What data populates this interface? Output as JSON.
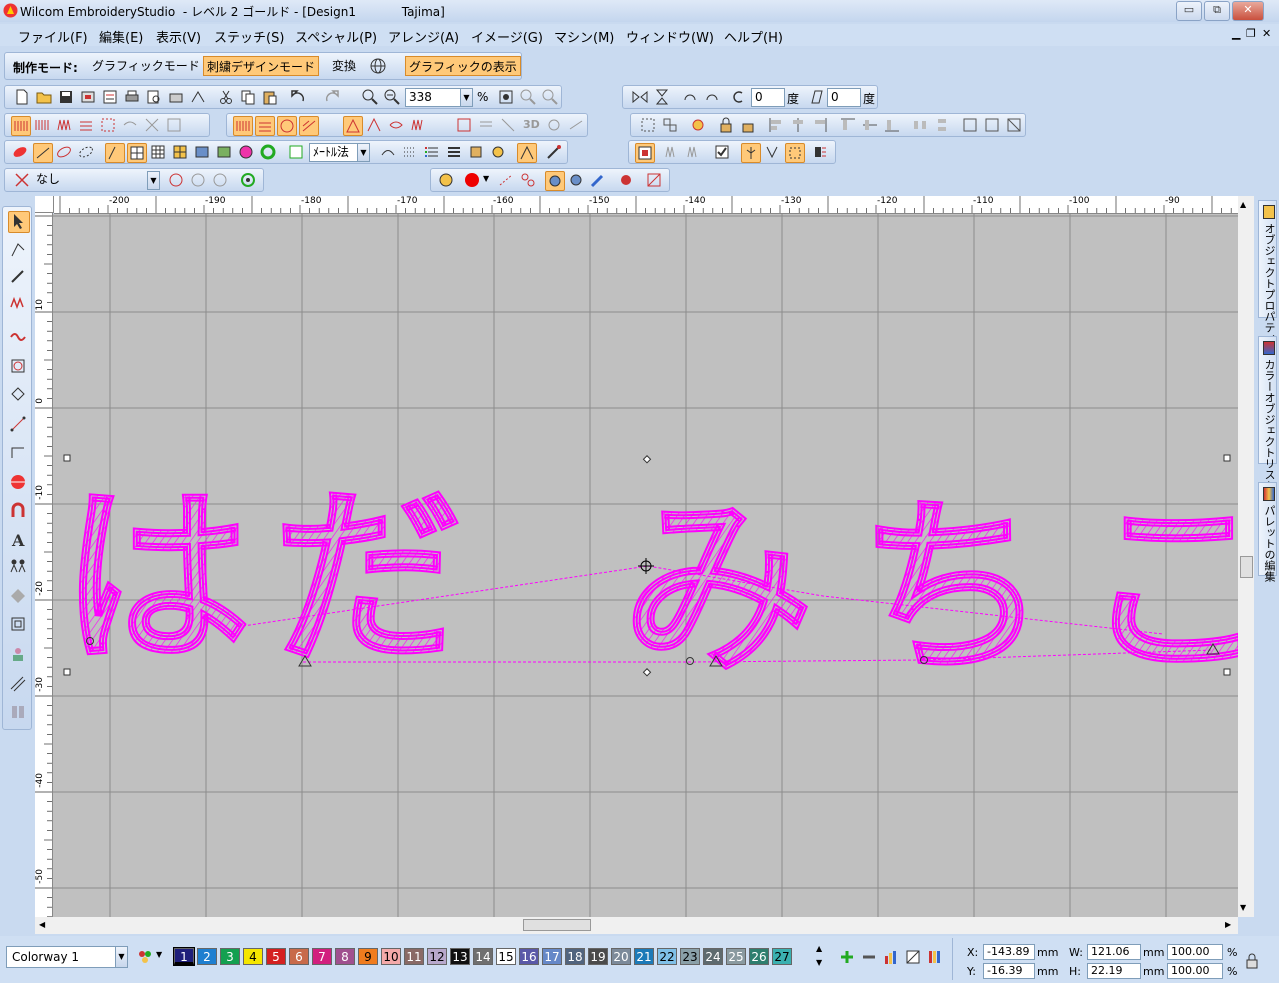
{
  "app": {
    "title": "Wilcom EmbroideryStudio  - レベル 2 ゴールド - [Design1            Tajima]",
    "window_buttons": {
      "minimize": "▭",
      "restore": "⧉",
      "close": "✕"
    },
    "mdi_buttons": {
      "minimize": "▁",
      "restore": "❐",
      "close": "✕"
    }
  },
  "menu": [
    "ファイル(F)",
    "編集(E)",
    "表示(V)",
    "ステッチ(S)",
    "スペシャル(P)",
    "アレンジ(A)",
    "イメージ(G)",
    "マシン(M)",
    "ウィンドウ(W)",
    "ヘルプ(H)"
  ],
  "mode_bar": {
    "label": "制作モード:",
    "graphic_mode": "グラフィックモード",
    "embroidery_mode": "刺繍デザインモード",
    "convert": "変換",
    "show_graphics": "グラフィックの表示"
  },
  "zoom": {
    "value": "338",
    "unit": "%"
  },
  "rotate": {
    "value": "0",
    "unit": "度"
  },
  "skew": {
    "value": "0",
    "unit": "度"
  },
  "unit_select": "ﾒｰﾄﾙ法",
  "thread_select": "なし",
  "ruler": {
    "top_labels": [
      "-200",
      "-190",
      "-180",
      "-170",
      "-160",
      "-150",
      "-140",
      "-130",
      "-120",
      "-110",
      "-100",
      "-90"
    ],
    "left_labels": [
      "10",
      "0",
      "-10",
      "-20",
      "-30",
      "-40",
      "-50"
    ]
  },
  "design_text": [
    "は",
    "だ",
    "み",
    "ち",
    "こ"
  ],
  "right_panels": [
    "オブジェクトプロパティ",
    "カラーオブジェクトリスト",
    "パレットの編集"
  ],
  "status": {
    "colorway": "Colorway 1",
    "swatches": [
      {
        "n": "1",
        "c": "#1f1f7a",
        "t": "#ffffff"
      },
      {
        "n": "2",
        "c": "#1e7fd0",
        "t": "#ffffff"
      },
      {
        "n": "3",
        "c": "#13a050",
        "t": "#ffffff"
      },
      {
        "n": "4",
        "c": "#f5e600",
        "t": "#000000"
      },
      {
        "n": "5",
        "c": "#d42020",
        "t": "#ffffff"
      },
      {
        "n": "6",
        "c": "#c86a4a",
        "t": "#ffffff"
      },
      {
        "n": "7",
        "c": "#d21f7e",
        "t": "#ffffff"
      },
      {
        "n": "8",
        "c": "#a0508f",
        "t": "#ffffff"
      },
      {
        "n": "9",
        "c": "#f07c1e",
        "t": "#000000"
      },
      {
        "n": "10",
        "c": "#f4a9a9",
        "t": "#000000"
      },
      {
        "n": "11",
        "c": "#8a6a66",
        "t": "#ffffff"
      },
      {
        "n": "12",
        "c": "#b8a8cc",
        "t": "#000000"
      },
      {
        "n": "13",
        "c": "#101010",
        "t": "#ffffff"
      },
      {
        "n": "14",
        "c": "#6f6f6f",
        "t": "#ffffff"
      },
      {
        "n": "15",
        "c": "#ffffff",
        "t": "#000000"
      },
      {
        "n": "16",
        "c": "#5a58a8",
        "t": "#ffffff"
      },
      {
        "n": "17",
        "c": "#6688c8",
        "t": "#ffffff"
      },
      {
        "n": "18",
        "c": "#51647e",
        "t": "#ffffff"
      },
      {
        "n": "19",
        "c": "#4b4b4b",
        "t": "#ffffff"
      },
      {
        "n": "20",
        "c": "#7c8a9a",
        "t": "#ffffff"
      },
      {
        "n": "21",
        "c": "#1c7ab8",
        "t": "#ffffff"
      },
      {
        "n": "22",
        "c": "#7fc0e8",
        "t": "#000000"
      },
      {
        "n": "23",
        "c": "#8aa0a8",
        "t": "#000000"
      },
      {
        "n": "24",
        "c": "#5e6a6e",
        "t": "#ffffff"
      },
      {
        "n": "25",
        "c": "#8a9aa0",
        "t": "#ffffff"
      },
      {
        "n": "26",
        "c": "#2e7e6e",
        "t": "#ffffff"
      },
      {
        "n": "27",
        "c": "#3ab0b0",
        "t": "#000000"
      }
    ],
    "x_label": "X:",
    "x_value": "-143.89",
    "x_unit": "mm",
    "y_label": "Y:",
    "y_value": "-16.39",
    "y_unit": "mm",
    "w_label": "W:",
    "w_value": "121.06",
    "w_unit": "mm",
    "w_pct": "100.00",
    "w_pct_unit": "%",
    "h_label": "H:",
    "h_value": "22.19",
    "h_unit": "mm",
    "h_pct": "100.00",
    "h_pct_unit": "%"
  }
}
